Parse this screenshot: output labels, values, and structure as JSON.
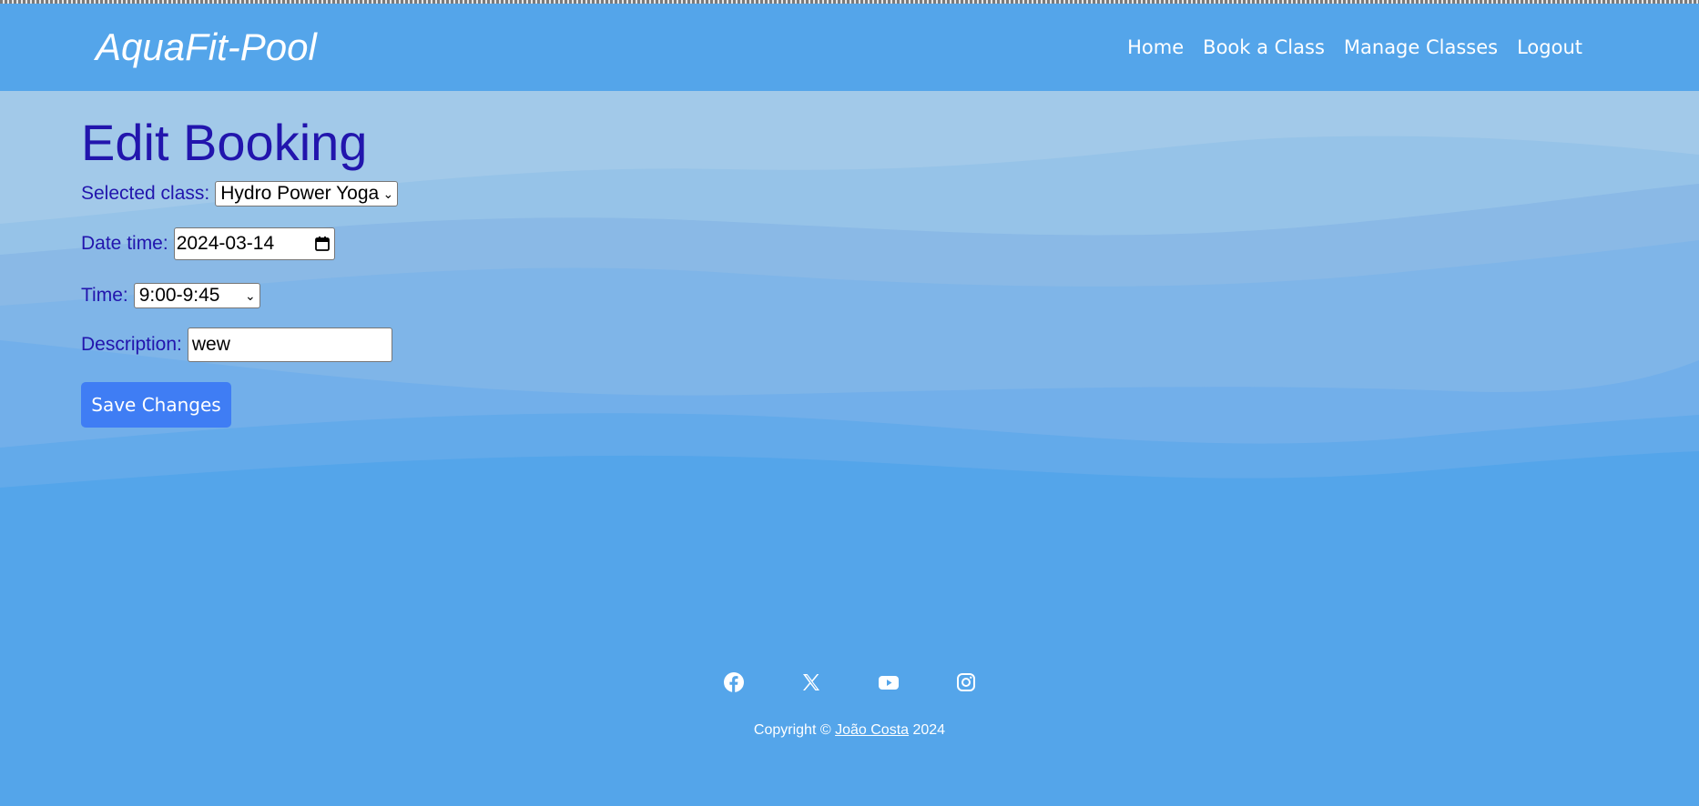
{
  "brand": "AquaFit-Pool",
  "nav": {
    "items": [
      "Home",
      "Book a Class",
      "Manage Classes",
      "Logout"
    ]
  },
  "page": {
    "title": "Edit Booking"
  },
  "form": {
    "class_label": "Selected class:",
    "class_value": "Hydro Power Yoga",
    "date_label": "Date time:",
    "date_value": "2024-03-14",
    "time_label": "Time:",
    "time_value": "9:00-9:45",
    "description_label": "Description:",
    "description_value": "wew",
    "save_label": "Save Changes"
  },
  "footer": {
    "socials": [
      "facebook-icon",
      "x-icon",
      "youtube-icon",
      "instagram-icon"
    ],
    "copyright_prefix": "Copyright ©",
    "author": "João Costa",
    "year": "2024"
  },
  "colors": {
    "header": "#54a5ea",
    "title": "#2215ad",
    "button": "#3f7df4"
  }
}
